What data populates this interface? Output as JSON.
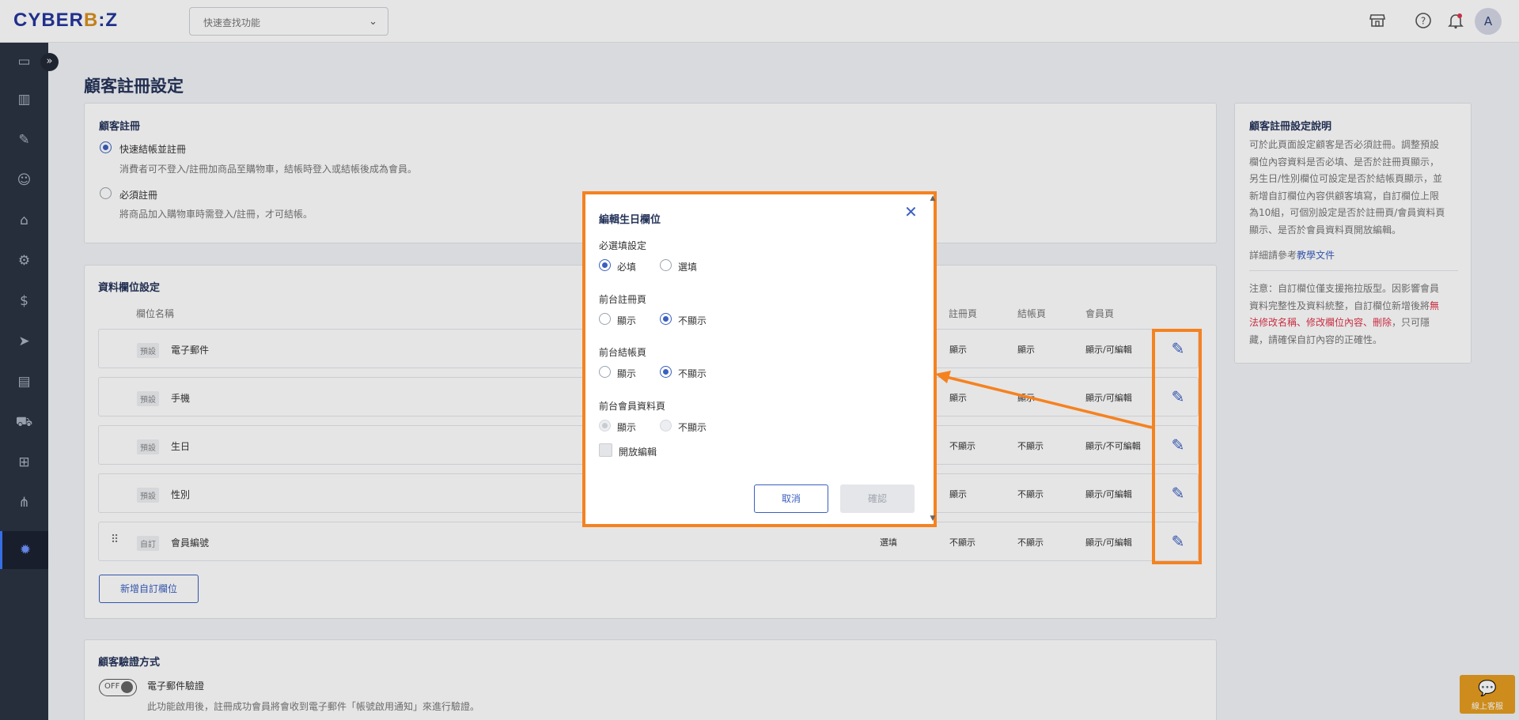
{
  "topbar": {
    "logo_text": "CYBERBIZ",
    "quick_search_placeholder": "快速查找功能",
    "avatar_letter": "A",
    "icons": [
      "store-icon",
      "help-icon",
      "bell-icon"
    ]
  },
  "sidebar": {
    "icons": [
      "dashboard-icon",
      "analytics-icon",
      "orders-icon",
      "customers-icon",
      "products-icon",
      "marketing-icon",
      "finance-icon",
      "promotion-icon",
      "store-design-icon",
      "logistics-icon",
      "apps-icon",
      "channels-icon",
      "settings-icon"
    ],
    "active": "settings-icon"
  },
  "page": {
    "title": "顧客註冊設定"
  },
  "registration": {
    "title": "顧客註冊",
    "opt1_label": "快速結帳並註冊",
    "opt1_desc": "消費者可不登入/註冊加商品至購物車，結帳時登入或結帳後成為會員。",
    "opt2_label": "必須註冊",
    "opt2_desc": "將商品加入購物車時需登入/註冊，才可結帳。"
  },
  "fields": {
    "title": "資料欄位設定",
    "headers": {
      "name": "欄位名稱",
      "register": "註冊頁",
      "checkout": "結帳頁",
      "member": "會員頁"
    },
    "rows": [
      {
        "tag": "預設",
        "name": "電子郵件",
        "required": "",
        "register": "顯示",
        "checkout": "顯示",
        "member": "顯示/可編輯"
      },
      {
        "tag": "預設",
        "name": "手機",
        "required": "",
        "register": "顯示",
        "checkout": "顯示",
        "member": "顯示/可編輯"
      },
      {
        "tag": "預設",
        "name": "生日",
        "required": "",
        "register": "不顯示",
        "checkout": "不顯示",
        "member": "顯示/不可編輯"
      },
      {
        "tag": "預設",
        "name": "性別",
        "required": "",
        "register": "顯示",
        "checkout": "不顯示",
        "member": "顯示/可編輯"
      },
      {
        "tag": "自訂",
        "name": "會員編號",
        "required": "選填",
        "register": "不顯示",
        "checkout": "不顯示",
        "member": "顯示/可編輯"
      }
    ],
    "add_button": "新增自訂欄位"
  },
  "verification": {
    "title": "顧客驗證方式",
    "toggle_text": "OFF",
    "label": "電子郵件驗證",
    "desc": "此功能啟用後，註冊成功會員將會收到電子郵件「帳號啟用通知」來進行驗證。"
  },
  "help": {
    "title": "顧客註冊設定說明",
    "paragraph_lines": [
      "可於此頁面設定顧客是否必須註冊。調整預設",
      "欄位內容資料是否必填、是否於註冊頁顯示，",
      "另生日/性別欄位可設定是否於結帳頁顯示，並",
      "新增自訂欄位內容供顧客填寫，自訂欄位上限",
      "為10組，可個別設定是否於註冊頁/會員資料頁",
      "顯示、是否於會員資料頁開放編輯。"
    ],
    "ref_prefix": "詳細請參考",
    "ref_link": "教學文件",
    "note_line1": "注意：自訂欄位僅支援拖拉版型。因影響會員",
    "note_line2_a": "資料完整性及資料統整，自訂欄位新增後將",
    "note_line2_b": "無",
    "note_line3_a": "法修改名稱、修改欄位內容、刪除",
    "note_line3_b": "，只可隱",
    "note_line4": "藏，請確保自訂內容的正確性。"
  },
  "modal": {
    "title": "編輯生日欄位",
    "required_section": "必選填設定",
    "required_opt": "必填",
    "optional_opt": "選填",
    "register_section": "前台註冊頁",
    "checkout_section": "前台結帳頁",
    "member_section": "前台會員資料頁",
    "show": "顯示",
    "hide": "不顯示",
    "allow_edit": "開放編輯",
    "cancel": "取消",
    "confirm": "確認"
  },
  "chat": {
    "label": "線上客服"
  },
  "colors": {
    "accent": "#3a5fc0",
    "highlight": "#f58220",
    "sidebar": "#2c3442",
    "warning": "#e0344a"
  }
}
